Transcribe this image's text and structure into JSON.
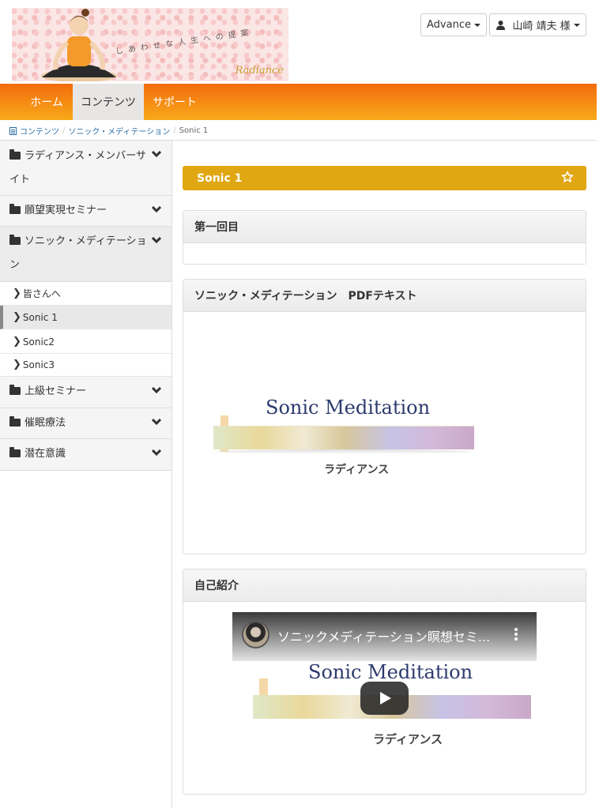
{
  "header": {
    "tagline": "しあわせな人生への提案",
    "logo_text": "Radiance",
    "advance_label": "Advance",
    "user_label": "山崎 靖夫 様"
  },
  "nav": {
    "items": [
      {
        "label": "ホーム"
      },
      {
        "label": "コンテンツ"
      },
      {
        "label": "サポート"
      }
    ]
  },
  "breadcrumb": {
    "items": [
      "コンテンツ",
      "ソニック・メディテーション",
      "Sonic 1"
    ],
    "separator": "/"
  },
  "sidebar": {
    "categories": [
      {
        "label": "ラディアンス・メンバーサイト"
      },
      {
        "label": "願望実現セミナー"
      },
      {
        "label": "ソニック・メディテーション"
      },
      {
        "label": "上級セミナー"
      },
      {
        "label": "催眠療法"
      },
      {
        "label": "潜在意識"
      }
    ],
    "sub_items": [
      {
        "label": "皆さんへ"
      },
      {
        "label": "Sonic 1"
      },
      {
        "label": "Sonic2"
      },
      {
        "label": "Sonic3"
      }
    ],
    "arrow": "❯"
  },
  "main": {
    "title": "Sonic 1",
    "panels": [
      {
        "heading": "第一回目"
      },
      {
        "heading": "ソニック・メディテーション　PDFテキスト",
        "image_title": "Sonic Meditation",
        "image_subtitle": "ラディアンス"
      },
      {
        "heading": "自己紹介",
        "video_title": "ソニックメディテーション瞑想セミ...",
        "image_title": "Sonic Meditation",
        "image_subtitle": "ラディアンス"
      }
    ]
  },
  "colors": {
    "nav_start": "#f36b0c",
    "nav_end": "#f8aa1a",
    "title_bar": "#e0a712",
    "link": "#2a6da8"
  }
}
